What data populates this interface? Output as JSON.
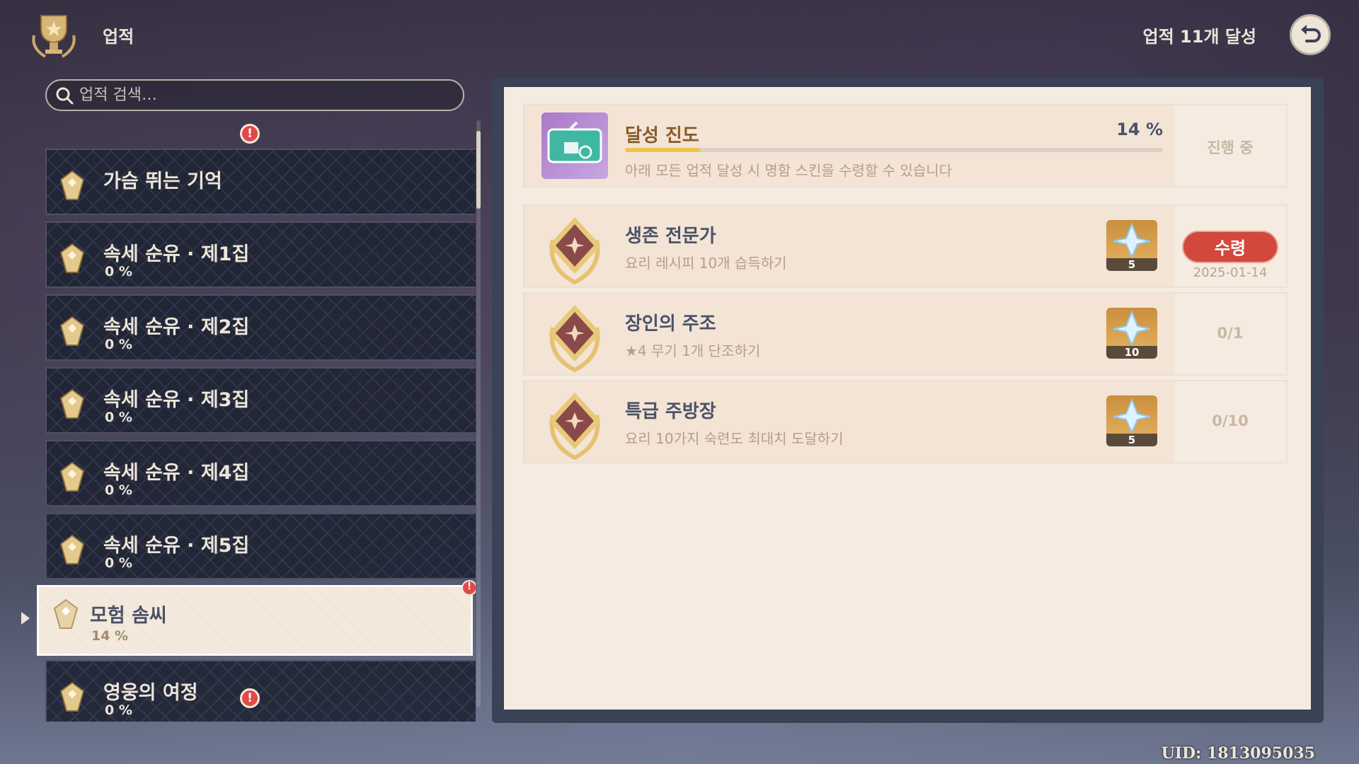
{
  "header": {
    "title": "업적",
    "achievement_count": "업적 11개 달성"
  },
  "search": {
    "placeholder": "업적 검색…"
  },
  "categories": [
    {
      "name": "가슴 뛰는 기억",
      "percent": ""
    },
    {
      "name": "속세 순유 · 제1집",
      "percent": "0 %"
    },
    {
      "name": "속세 순유 · 제2집",
      "percent": "0 %"
    },
    {
      "name": "속세 순유 · 제3집",
      "percent": "0 %"
    },
    {
      "name": "속세 순유 · 제4집",
      "percent": "0 %"
    },
    {
      "name": "속세 순유 · 제5집",
      "percent": "0 %"
    },
    {
      "name": "모험 솜씨",
      "percent": "14 %"
    },
    {
      "name": "영웅의 여정",
      "percent": "0 %"
    }
  ],
  "alert_mark": "!",
  "summary": {
    "title": "달성 진도",
    "percent_label": "14 %",
    "progress": 0.14,
    "desc": "아래 모든 업적 달성 시 명함 스킨을 수령할 수 있습니다",
    "status": "진행 중"
  },
  "achievements": [
    {
      "title": "생존 전문가",
      "desc": "요리 레시피 10개 습득하기",
      "reward_count": "5",
      "claim_label": "수령",
      "date": "2025-01-14"
    },
    {
      "title": "장인의 주조",
      "desc": "★4 무기 1개 단조하기",
      "reward_count": "10",
      "progress": "0/1"
    },
    {
      "title": "특급 주방장",
      "desc": "요리 10가지 숙련도 최대치 도달하기",
      "reward_count": "5",
      "progress": "0/10"
    }
  ],
  "uid": "UID: 1813095035",
  "colors": {
    "accent": "#d2483d",
    "progress_fill": "#f2c34a",
    "panel": "#f6ebe0"
  }
}
